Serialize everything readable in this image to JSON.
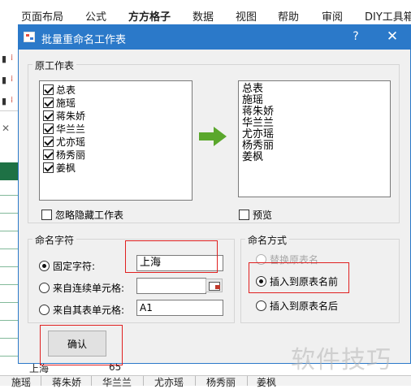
{
  "excel": {
    "ribbon_tabs": [
      "页面布局",
      "公式",
      "方方格子",
      "数据",
      "视图",
      "帮助",
      "审阅",
      "DIY工具箱"
    ],
    "bottom_value": "上海",
    "bottom_value2": "65",
    "sheet_tabs": [
      "施瑶",
      "蒋朱娇",
      "华兰兰",
      "尤亦瑶",
      "杨秀丽",
      "姜枫"
    ]
  },
  "dialog": {
    "title": "批量重命名工作表",
    "help": "?",
    "close": "✕",
    "original_group_label": "原工作表",
    "sheets": [
      {
        "name": "总表",
        "checked": true
      },
      {
        "name": "施瑶",
        "checked": true
      },
      {
        "name": "蒋朱娇",
        "checked": true
      },
      {
        "name": "华兰兰",
        "checked": true
      },
      {
        "name": "尤亦瑶",
        "checked": true
      },
      {
        "name": "杨秀丽",
        "checked": true
      },
      {
        "name": "姜枫",
        "checked": true
      }
    ],
    "preview_list": [
      "总表",
      "施瑶",
      "蒋朱娇",
      "华兰兰",
      "尤亦瑶",
      "杨秀丽",
      "姜枫"
    ],
    "ignore_hidden_label": "忽略隐藏工作表",
    "preview_label": "预览",
    "naming_chars_label": "命名字符",
    "fixed_chars_label": "固定字符:",
    "fixed_chars_value": "上海",
    "from_continuous_label": "来自连续单元格:",
    "from_continuous_value": "",
    "from_other_label": "来自其表单元格:",
    "from_other_value": "A1",
    "naming_mode_label": "命名方式",
    "mode_replace": "替换原表名",
    "mode_insert_before": "插入到原表名前",
    "mode_insert_after": "插入到原表名后",
    "ok_label": "确认"
  },
  "watermark": "软件技巧",
  "colors": {
    "titlebar": "#2b79c9",
    "arrow": "#5aa72c",
    "highlight": "#e02020",
    "excel_green": "#1e7145"
  }
}
